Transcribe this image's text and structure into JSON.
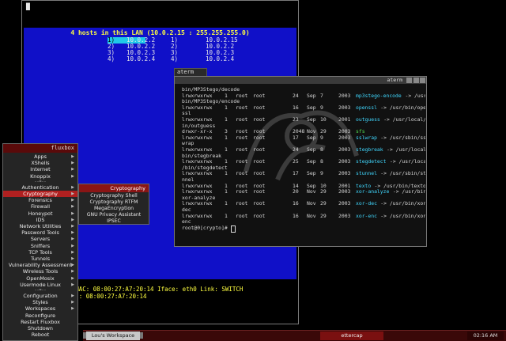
{
  "ettercap": {
    "top_line": "█",
    "hosts_title": "4 hosts in this LAN (10.0.2.15 : 255.255.255.0)",
    "hosts_left": [
      {
        "num": "1)",
        "ip": "10.0.2.2"
      },
      {
        "num": "2)",
        "ip": "10.0.2.2"
      },
      {
        "num": "3)",
        "ip": "10.0.2.3"
      },
      {
        "num": "4)",
        "ip": "10.0.2.4"
      }
    ],
    "hosts_right": [
      {
        "num": "1)",
        "ip": "10.0.2.15"
      },
      {
        "num": "2)",
        "ip": "10.0.2.2"
      },
      {
        "num": "3)",
        "ip": "10.0.2.3"
      },
      {
        "num": "4)",
        "ip": "10.0.2.4"
      }
    ],
    "status_line1": "IP: 10.0.2.15 MAC: 08:00:27:A7:20:14 Iface: eth0 Link: SWITCH",
    "status_line2": "st (10.0.2.15) : 08:00:27:A7:20:14"
  },
  "aterm": {
    "tab_label": "aterm",
    "title": "aterm",
    "lines": [
      {
        "t": "bin/MP3Stego/decode"
      },
      {
        "perm": "lrwxrwxrwx",
        "n": "1",
        "u": "root",
        "g": "root",
        "size": "24",
        "mon": "Sep",
        "day": "7",
        "yr": "2003",
        "name": "mp3stego-encode",
        "target": "-> /usr/"
      },
      {
        "t": "bin/MP3Stego/encode"
      },
      {
        "perm": "lrwxrwxrwx",
        "n": "1",
        "u": "root",
        "g": "root",
        "size": "16",
        "mon": "Sep",
        "day": "9",
        "yr": "2003",
        "name": "openssl",
        "target": "-> /usr/bin/open"
      },
      {
        "t": "ssl"
      },
      {
        "perm": "lrwxrwxrwx",
        "n": "1",
        "u": "root",
        "g": "root",
        "size": "23",
        "mon": "Sep",
        "day": "10",
        "yr": "2001",
        "name": "outguess",
        "target": "-> /usr/local/b"
      },
      {
        "t": "in/outguess"
      },
      {
        "perm": "drwxr-xr-x",
        "n": "3",
        "u": "root",
        "g": "root",
        "size": "2048",
        "mon": "Nov",
        "day": "29",
        "yr": "2003",
        "name": "sfs",
        "target": ""
      },
      {
        "perm": "lrwxrwxrwx",
        "n": "1",
        "u": "root",
        "g": "root",
        "size": "17",
        "mon": "Sep",
        "day": "9",
        "yr": "2003",
        "name": "sslwrap",
        "target": "-> /usr/sbin/ssl"
      },
      {
        "t": "wrap"
      },
      {
        "perm": "lrwxrwxrwx",
        "n": "1",
        "u": "root",
        "g": "root",
        "size": "24",
        "mon": "Sep",
        "day": "8",
        "yr": "2003",
        "name": "stegbreak",
        "target": "-> /usr/local/"
      },
      {
        "t": "bin/stegbreak"
      },
      {
        "perm": "lrwxrwxrwx",
        "n": "1",
        "u": "root",
        "g": "root",
        "size": "25",
        "mon": "Sep",
        "day": "8",
        "yr": "2003",
        "name": "stegdetect",
        "target": "-> /usr/local"
      },
      {
        "t": "/bin/stegdetect"
      },
      {
        "perm": "lrwxrwxrwx",
        "n": "1",
        "u": "root",
        "g": "root",
        "size": "17",
        "mon": "Sep",
        "day": "9",
        "yr": "2003",
        "name": "stunnel",
        "target": "-> /usr/sbin/stu"
      },
      {
        "t": "nnel"
      },
      {
        "perm": "lrwxrwxrwx",
        "n": "1",
        "u": "root",
        "g": "root",
        "size": "14",
        "mon": "Sep",
        "day": "10",
        "yr": "2001",
        "name": "texto",
        "target": "-> /usr/bin/texto"
      },
      {
        "perm": "lrwxrwxrwx",
        "n": "1",
        "u": "root",
        "g": "root",
        "size": "20",
        "mon": "Nov",
        "day": "29",
        "yr": "2003",
        "name": "xor-analyze",
        "target": "-> /usr/bin/"
      },
      {
        "t": "xor-analyze"
      },
      {
        "perm": "lrwxrwxrwx",
        "n": "1",
        "u": "root",
        "g": "root",
        "size": "16",
        "mon": "Nov",
        "day": "29",
        "yr": "2003",
        "name": "xor-dec",
        "target": "-> /usr/bin/xor-"
      },
      {
        "t": "dec"
      },
      {
        "perm": "lrwxrwxrwx",
        "n": "1",
        "u": "root",
        "g": "root",
        "size": "16",
        "mon": "Nov",
        "day": "29",
        "yr": "2003",
        "name": "xor-enc",
        "target": "-> /usr/bin/xor-"
      },
      {
        "t": "enc"
      }
    ],
    "prompt": "root@0[crypto]# "
  },
  "fluxbox": {
    "title": "fluxbox",
    "items": [
      {
        "label": "Apps",
        "sub": true
      },
      {
        "label": "XShells",
        "sub": true
      },
      {
        "label": "Internet",
        "sub": true
      },
      {
        "label": "Knoppix",
        "sub": true
      },
      {
        "sep": "--=--"
      },
      {
        "label": "Authentication",
        "sub": true
      },
      {
        "label": "Cryptography",
        "sub": true,
        "active": true
      },
      {
        "label": "Forensics",
        "sub": true
      },
      {
        "label": "Firewall",
        "sub": true
      },
      {
        "label": "Honeypot",
        "sub": true
      },
      {
        "label": "IDS",
        "sub": true
      },
      {
        "label": "Network Utilities",
        "sub": true
      },
      {
        "label": "Password Tools",
        "sub": true
      },
      {
        "label": "Servers",
        "sub": true
      },
      {
        "label": "Sniffers",
        "sub": true
      },
      {
        "label": "TCP Tools",
        "sub": true
      },
      {
        "label": "Tunnels",
        "sub": true
      },
      {
        "label": "Vulnerability Assessment",
        "sub": true
      },
      {
        "label": "Wireless Tools",
        "sub": true
      },
      {
        "label": "OpenMosix",
        "sub": true
      },
      {
        "label": "Usermode Linux",
        "sub": true
      },
      {
        "sep": "--=--"
      },
      {
        "label": "Configuration",
        "sub": true
      },
      {
        "label": "Styles",
        "sub": true
      },
      {
        "label": "Workspaces",
        "sub": true
      },
      {
        "label": "Reconfigure",
        "sub": false
      },
      {
        "label": "Restart Fluxbox",
        "sub": false
      },
      {
        "label": "Shutdown",
        "sub": false
      },
      {
        "label": "Reboot",
        "sub": false
      }
    ]
  },
  "crypto_menu": {
    "title": "Cryptography",
    "items": [
      "Cryptography Shell",
      "Cryptography RTFM",
      "MegaEncryption",
      "GNU Privacy Assistant",
      "IPSEC"
    ]
  },
  "taskbar": {
    "workspace": "Lou's Workspace",
    "task": "ettercap",
    "clock": "02:16 AM"
  },
  "colors": {
    "ettercap_blue": "#1010c8",
    "highlight_cyan": "#20c8e8",
    "menu_active": "#b02020",
    "taskbar": "#3a0808"
  }
}
